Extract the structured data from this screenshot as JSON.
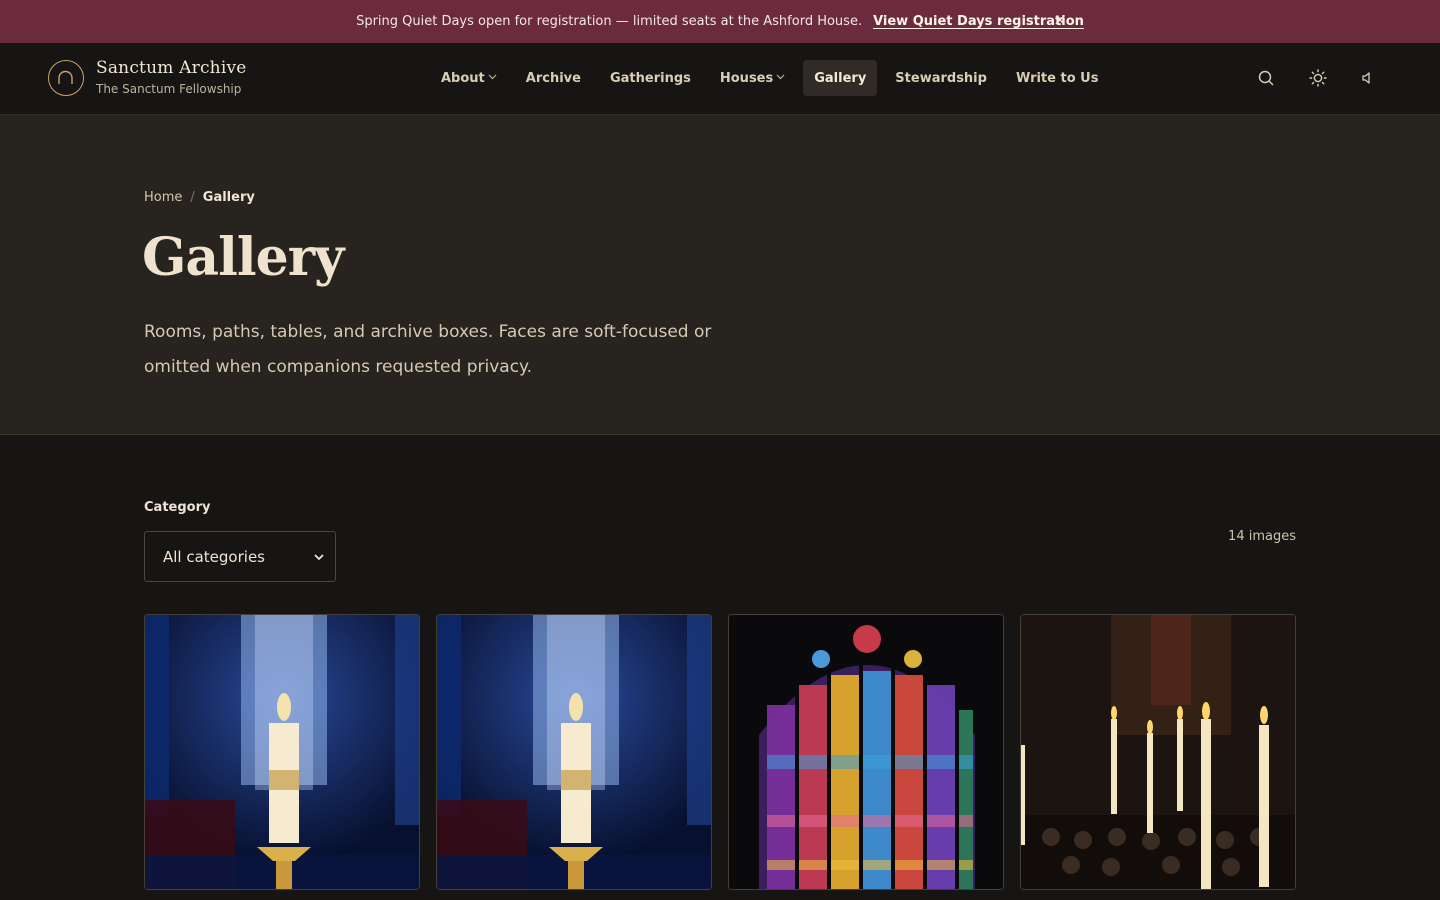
{
  "announcement": {
    "message": "Spring Quiet Days open for registration — limited seats at the Ashford House.",
    "link_label": "View Quiet Days registration",
    "close_label": "×"
  },
  "brand": {
    "name": "Sanctum Archive",
    "subtitle": "The Sanctum Fellowship"
  },
  "nav": {
    "items": [
      {
        "label": "About",
        "has_menu": true
      },
      {
        "label": "Archive",
        "has_menu": false
      },
      {
        "label": "Gatherings",
        "has_menu": false
      },
      {
        "label": "Houses",
        "has_menu": true
      },
      {
        "label": "Gallery",
        "has_menu": false,
        "active": true
      },
      {
        "label": "Stewardship",
        "has_menu": false
      },
      {
        "label": "Write to Us",
        "has_menu": false
      }
    ],
    "icons": [
      "search-icon",
      "sun-icon",
      "speaker-icon"
    ]
  },
  "breadcrumb": {
    "home": "Home",
    "separator": "/",
    "current": "Gallery"
  },
  "page": {
    "title": "Gallery",
    "intro": "Rooms, paths, tables, and archive boxes. Faces are soft-focused or omitted when companions requested privacy."
  },
  "filter": {
    "label": "Category",
    "selected": "All categories",
    "count_label": "14 images"
  },
  "gallery": {
    "tiles": [
      {
        "subject": "candle-before-blue-window"
      },
      {
        "subject": "candle-before-blue-window"
      },
      {
        "subject": "stained-glass-window"
      },
      {
        "subject": "candles-in-chapel"
      }
    ]
  },
  "colors": {
    "announcement_bg": "#6b2a3d",
    "header_bg": "#171513",
    "hero_bg": "#27231f",
    "accent_gold": "#c7a36a"
  }
}
